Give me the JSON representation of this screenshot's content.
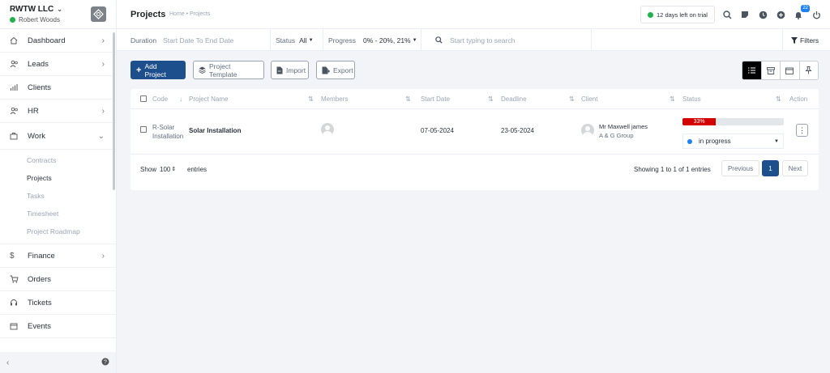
{
  "sidebar": {
    "company": "RWTW LLC",
    "user": "Robert Woods",
    "items": [
      {
        "label": "Dashboard",
        "icon": "home-icon"
      },
      {
        "label": "Leads",
        "icon": "users-icon"
      },
      {
        "label": "Clients",
        "icon": "chart-icon"
      },
      {
        "label": "HR",
        "icon": "users-icon"
      },
      {
        "label": "Work",
        "icon": "briefcase-icon"
      },
      {
        "label": "Finance",
        "icon": "dollar-icon"
      },
      {
        "label": "Orders",
        "icon": "cart-icon"
      },
      {
        "label": "Tickets",
        "icon": "headset-icon"
      },
      {
        "label": "Events",
        "icon": "calendar-icon"
      }
    ],
    "work_sub": [
      "Contracts",
      "Projects",
      "Tasks",
      "Timesheet",
      "Project Roadmap"
    ]
  },
  "header": {
    "title": "Projects",
    "breadcrumb": "Home • Projects",
    "trial": "12 days left on trial",
    "notification_count": "22"
  },
  "filters": {
    "duration_label": "Duration",
    "duration_value": "Start Date To End Date",
    "status_label": "Status",
    "status_value": "All",
    "progress_label": "Progress",
    "progress_value": "0% - 20%, 21%",
    "search_placeholder": "Start typing to search",
    "filters_label": "Filters"
  },
  "toolbar": {
    "add": "Add Project",
    "template": "Project Template",
    "import": "Import",
    "export": "Export"
  },
  "table": {
    "headers": [
      "Code",
      "Project Name",
      "Members",
      "Start Date",
      "Deadline",
      "Client",
      "Status",
      "Action"
    ],
    "row": {
      "code_1": "R-Solar",
      "code_2": "Installation",
      "name": "Solar Installation",
      "start": "07-05-2024",
      "deadline": "23-05-2024",
      "client_name": "Mr Maxwell james",
      "client_company": "A & G Group",
      "progress_label": "33%",
      "progress_fraction": 0.33,
      "status": "in progress"
    }
  },
  "footer": {
    "show": "Show",
    "entries_value": "100",
    "entries": "entries",
    "info": "Showing 1 to 1 of 1 entries",
    "previous": "Previous",
    "page": "1",
    "next": "Next"
  },
  "colors": {
    "primary": "#1d4f8c",
    "progress": "#d30000",
    "status_dot": "#1d82f5",
    "online": "#22b14c"
  }
}
